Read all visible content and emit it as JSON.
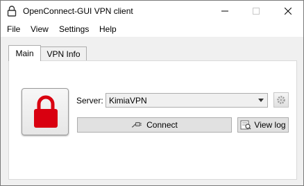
{
  "window": {
    "title": "OpenConnect-GUI VPN client"
  },
  "menu": {
    "items": [
      "File",
      "View",
      "Settings",
      "Help"
    ]
  },
  "tabs": [
    {
      "label": "Main",
      "selected": true
    },
    {
      "label": "VPN Info",
      "selected": false
    }
  ],
  "main": {
    "server_label": "Server:",
    "server_value": "KimiaVPN",
    "connect_label": "Connect",
    "viewlog_label": "View log"
  },
  "colors": {
    "lock": "#d90010",
    "accent": "#0078d7"
  },
  "icons": {
    "title": "lock-outline-icon",
    "status": "red-lock-icon",
    "settings": "gear-icon",
    "connect": "plug-icon",
    "viewlog": "log-icon"
  }
}
